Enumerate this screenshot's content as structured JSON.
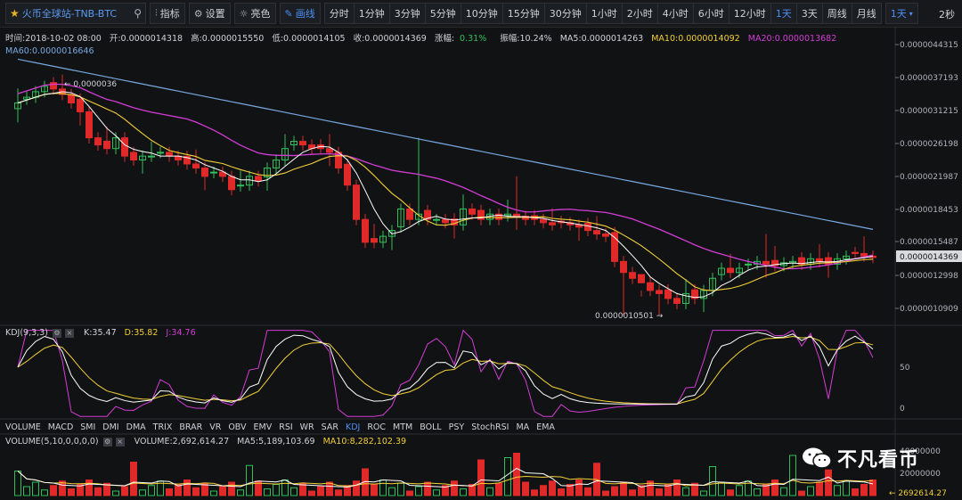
{
  "toolbar": {
    "symbol": "火币全球站-TNB-BTC",
    "indicators": "指标",
    "settings": "设置",
    "theme": "亮色",
    "draw": "画线",
    "periods": [
      "分时",
      "1分钟",
      "3分钟",
      "5分钟",
      "10分钟",
      "15分钟",
      "30分钟",
      "1小时",
      "2小时",
      "4小时",
      "6小时",
      "12小时",
      "1天",
      "3天",
      "周线",
      "月线"
    ],
    "active_period": "1天",
    "day_select": "1天",
    "refresh": "2秒"
  },
  "info": {
    "time": "时间:2018-10-02 08:00",
    "open": "开:0.0000014318",
    "high": "高:0.0000015550",
    "low": "低:0.0000014105",
    "close": "收:0.0000014369",
    "change": "涨幅:",
    "change_val": "0.31%",
    "amplitude": "振幅:10.24%",
    "ma5": "MA5:0.0000014263",
    "ma10": "MA10:0.0000014092",
    "ma20": "MA20:0.0000013682",
    "ma60": "MA60:0.0000016646"
  },
  "price_axis": [
    "0.0000044315",
    "0.0000037193",
    "0.0000031215",
    "0.0000026198",
    "0.0000021987",
    "0.0000018453",
    "0.0000015487",
    "0.0000012998",
    "0.0000010909"
  ],
  "last_price": "0.0000014369",
  "high_marker": "← 0.0000036",
  "low_marker": "0.0000010501 →",
  "kdj": {
    "label": "KDJ(9,3,3)",
    "k": "K:35.47",
    "d": "D:35.82",
    "j": "J:34.76",
    "axis": [
      "50",
      "0"
    ]
  },
  "indicator_tabs": [
    "VOLUME",
    "MACD",
    "SMI",
    "DMI",
    "DMA",
    "TRIX",
    "BRAR",
    "VR",
    "OBV",
    "EMV",
    "RSI",
    "WR",
    "SAR",
    "KDJ",
    "ROC",
    "MTM",
    "BOLL",
    "PSY",
    "StochRSI",
    "MA",
    "EMA"
  ],
  "active_tab": "KDJ",
  "volume": {
    "label": "VOLUME(5,10,0,0,0,0)",
    "vol": "VOLUME:2,692,614.27",
    "ma5": "MA5:5,189,103.69",
    "ma10": "MA10:8,282,102.39",
    "axis": [
      "40000000",
      "20000000"
    ],
    "last": "← 2692614.27"
  },
  "watermark": "不凡看币",
  "chart_data": {
    "type": "candlestick",
    "close": [
      3.25,
      3.35,
      3.45,
      3.55,
      3.5,
      3.4,
      3.25,
      3.1,
      2.7,
      2.6,
      2.55,
      2.7,
      2.45,
      2.4,
      2.45,
      2.45,
      2.5,
      2.45,
      2.4,
      2.35,
      2.3,
      2.2,
      2.25,
      2.2,
      2.05,
      2.1,
      2.2,
      2.15,
      2.3,
      2.4,
      2.55,
      2.65,
      2.6,
      2.55,
      2.55,
      2.5,
      2.3,
      2.1,
      1.75,
      1.55,
      1.55,
      1.6,
      1.65,
      1.85,
      1.75,
      1.8,
      1.75,
      1.75,
      1.72,
      1.7,
      1.85,
      1.8,
      1.75,
      1.8,
      1.75,
      1.8,
      1.78,
      1.75,
      1.75,
      1.72,
      1.7,
      1.72,
      1.7,
      1.68,
      1.65,
      1.62,
      1.6,
      1.4,
      1.32,
      1.28,
      1.25,
      1.2,
      1.18,
      1.15,
      1.12,
      1.18,
      1.15,
      1.2,
      1.28,
      1.35,
      1.32,
      1.35,
      1.38,
      1.4,
      1.38,
      1.37,
      1.39,
      1.4,
      1.38,
      1.42,
      1.4,
      1.38,
      1.42,
      1.44,
      1.46,
      1.44,
      1.43
    ],
    "ma_series": [
      {
        "name": "MA5",
        "color": "#ffffff"
      },
      {
        "name": "MA10",
        "color": "#f2d038"
      },
      {
        "name": "MA20",
        "color": "#d33dd6"
      },
      {
        "name": "MA60",
        "color": "#78a8e0"
      }
    ],
    "kdj": [
      {
        "name": "K",
        "color": "#ffffff"
      },
      {
        "name": "D",
        "color": "#f2d038"
      },
      {
        "name": "J",
        "color": "#d33dd6"
      }
    ]
  }
}
